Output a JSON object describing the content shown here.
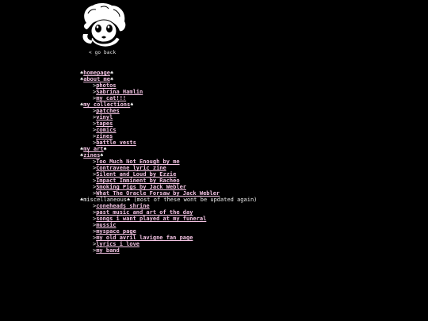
{
  "go_back": "< go back",
  "star": "♠",
  "arrow": ">",
  "sections": {
    "homepage": "homepage",
    "about": "about me",
    "collections": "my collections",
    "art": "my art",
    "zines": "zines",
    "misc": "miscellaneous",
    "misc_note": " (most of these wont be updated again)"
  },
  "about_items": [
    "photos",
    "Sabrina Hamlin",
    "my cat!!!"
  ],
  "collection_items": [
    "patches",
    "vinyl",
    "tapes",
    "comics",
    "zines",
    "battle vests"
  ],
  "zine_items": [
    "Too Much Not Enough by me",
    "Contravene lyric zine",
    "Silent and Loud by Ezzie",
    "Impact Imminent by Racheo",
    "Smoking Pigs by Jack Webler",
    "What The Oracle Forsaw by Jack Webler"
  ],
  "misc_items": [
    "coneheads shrine",
    "past music and art of the day",
    "songs i want played at my funeral",
    "mussic",
    "myspace page",
    "my old avril lavigne fan page",
    "lyrics i love",
    "my band"
  ]
}
